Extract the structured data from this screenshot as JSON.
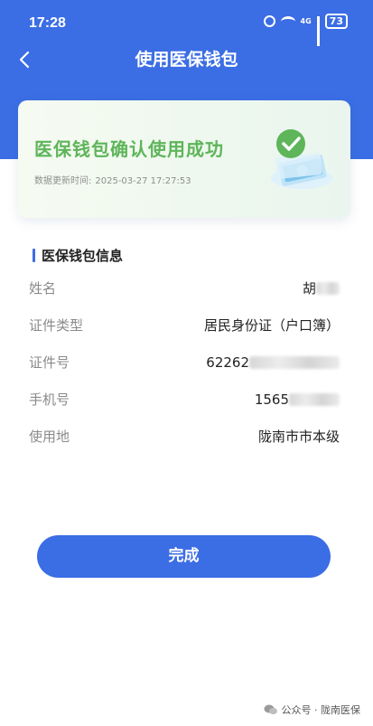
{
  "status_bar": {
    "time": "17:28",
    "network": "4G",
    "battery": "73"
  },
  "nav": {
    "title": "使用医保钱包"
  },
  "result_card": {
    "title": "医保钱包确认使用成功",
    "update_label": "数据更新时间:",
    "update_time": "2025-03-27 17:27:53"
  },
  "section": {
    "title": "医保钱包信息"
  },
  "info": {
    "name_label": "姓名",
    "name_value": "胡",
    "id_type_label": "证件类型",
    "id_type_value": "居民身份证（户口簿）",
    "id_no_label": "证件号",
    "id_no_value": "62262",
    "phone_label": "手机号",
    "phone_value": "1565",
    "location_label": "使用地",
    "location_value": "陇南市市本级"
  },
  "actions": {
    "done_label": "完成"
  },
  "footer": {
    "text": "公众号 · 陇南医保"
  },
  "colors": {
    "primary": "#3b6de4",
    "success": "#5eb55a"
  }
}
